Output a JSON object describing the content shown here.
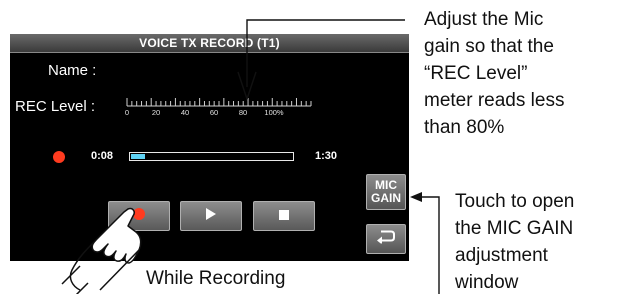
{
  "screen": {
    "title": "VOICE TX RECORD (T1)",
    "name_label": "Name :",
    "rec_level_label": "REC Level :",
    "meter_scale": [
      "0",
      "20",
      "40",
      "60",
      "80",
      "100%"
    ],
    "elapsed_time": "0:08",
    "total_time": "1:30",
    "progress_fraction": 0.09,
    "buttons": {
      "record_icon": "record-icon",
      "play_icon": "play-icon",
      "stop_icon": "stop-icon",
      "mic_gain_label_line1": "MIC",
      "mic_gain_label_line2": "GAIN",
      "back_icon": "return-icon"
    }
  },
  "annotations": {
    "adjust_lines": [
      "Adjust the Mic",
      "gain so that the",
      "“REC Level”",
      "meter reads less",
      "than 80%"
    ],
    "touch_lines": [
      "Touch to open",
      "the MIC GAIN",
      "adjustment",
      "window"
    ],
    "while_recording": "While Recording"
  },
  "colors": {
    "record_red": "#ff3b1f",
    "progress_cyan": "#5fd3f5",
    "screen_bg": "#000000"
  }
}
